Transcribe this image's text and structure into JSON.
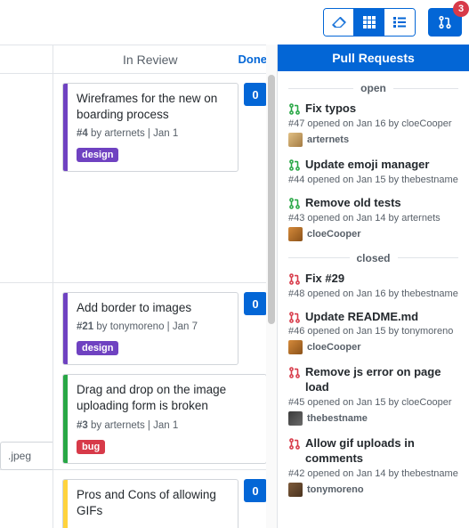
{
  "toolbar": {
    "pr_badge": "3"
  },
  "columns": {
    "in_review": {
      "title": "In Review",
      "done_label": "Done",
      "cards": [
        {
          "title": "Wireframes for the new on boarding process",
          "num": "#4",
          "by": "arternets",
          "date": "Jan 1",
          "label": "design",
          "count": "0",
          "bar": "purple",
          "label_class": "label-design"
        },
        {
          "title": "Add border to images",
          "num": "#21",
          "by": "tonymoreno",
          "date": "Jan 7",
          "label": "design",
          "count": "0",
          "bar": "purple",
          "label_class": "label-design"
        },
        {
          "title": "Drag and drop on the image uploading form is broken",
          "num": "#3",
          "by": "arternets",
          "date": "Jan 1",
          "label": "bug",
          "count": "",
          "bar": "green",
          "label_class": "label-bug"
        },
        {
          "title": "Pros and Cons of allowing GIFs",
          "num": "",
          "by": "",
          "date": "",
          "label": "",
          "count": "0",
          "bar": "yellow",
          "label_class": ""
        }
      ]
    },
    "partial_card_text": ".jpeg"
  },
  "pr_panel": {
    "title": "Pull Requests",
    "open_label": "open",
    "closed_label": "closed",
    "open": [
      {
        "title": "Fix typos",
        "meta": "#47 opened on Jan 16 by cloeCooper",
        "assignee": "arternets",
        "av": "av-a"
      },
      {
        "title": "Update emoji manager",
        "meta": "#44 opened on Jan 15 by thebestname",
        "assignee": "",
        "av": ""
      },
      {
        "title": "Remove old tests",
        "meta": "#43 opened on Jan 14 by arternets",
        "assignee": "cloeCooper",
        "av": "av-c"
      }
    ],
    "closed": [
      {
        "title": "Fix #29",
        "meta": "#48 opened on Jan 16 by thebestname",
        "assignee": "",
        "av": ""
      },
      {
        "title": "Update README.md",
        "meta": "#46 opened on Jan 15 by tonymoreno",
        "assignee": "cloeCooper",
        "av": "av-c"
      },
      {
        "title": "Remove js error on page load",
        "meta": "#45 opened on Jan 15 by cloeCooper",
        "assignee": "thebestname",
        "av": "av-b"
      },
      {
        "title": "Allow gif uploads in comments",
        "meta": "#42 opened on Jan 14 by thebestname",
        "assignee": "tonymoreno",
        "av": "av-d"
      }
    ]
  }
}
